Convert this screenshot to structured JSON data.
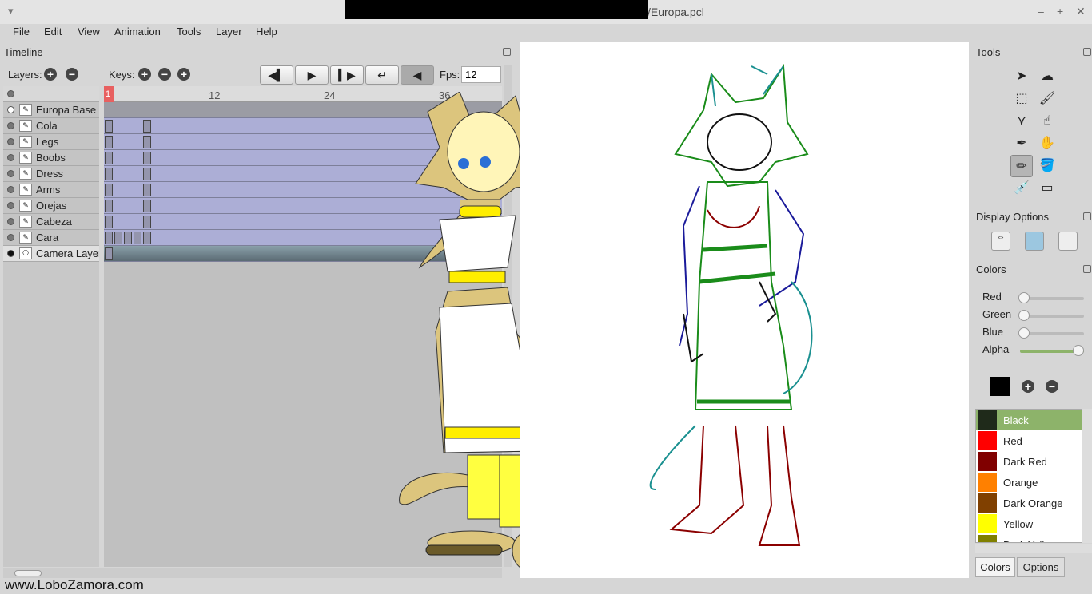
{
  "window": {
    "title": "/Europa.pcl"
  },
  "menu": [
    "File",
    "Edit",
    "View",
    "Animation",
    "Tools",
    "Layer",
    "Help"
  ],
  "timeline": {
    "title": "Timeline",
    "layers_label": "Layers:",
    "keys_label": "Keys:",
    "fps_label": "Fps:",
    "fps": "12",
    "current_frame": "1",
    "ruler_ticks": [
      "12",
      "24",
      "36"
    ],
    "layers": [
      {
        "name": "Europa Base",
        "type": "bitmap",
        "keys": []
      },
      {
        "name": "Cola",
        "keys": [
          1,
          5
        ]
      },
      {
        "name": "Legs",
        "keys": [
          1,
          5
        ]
      },
      {
        "name": "Boobs",
        "keys": [
          1,
          5
        ]
      },
      {
        "name": "Dress",
        "keys": [
          1,
          5
        ]
      },
      {
        "name": "Arms",
        "keys": [
          1,
          5
        ]
      },
      {
        "name": "Orejas",
        "keys": [
          1,
          5
        ]
      },
      {
        "name": "Cabeza",
        "keys": [
          1,
          5
        ]
      },
      {
        "name": "Cara",
        "keys": [
          1,
          2,
          3,
          4,
          5
        ]
      },
      {
        "name": "Camera Layer",
        "type": "camera",
        "keys": [
          1
        ]
      }
    ]
  },
  "tools": {
    "title": "Tools",
    "items": [
      "select",
      "smudge",
      "marquee",
      "brush",
      "polyline",
      "pointer-hand",
      "pen",
      "hand",
      "pencil",
      "bucket",
      "eyedropper",
      "eraser"
    ],
    "active": "pencil"
  },
  "display_options": {
    "title": "Display Options"
  },
  "colors": {
    "title": "Colors",
    "sliders": [
      {
        "label": "Red",
        "value": 0
      },
      {
        "label": "Green",
        "value": 0
      },
      {
        "label": "Blue",
        "value": 0
      },
      {
        "label": "Alpha",
        "value": 255
      }
    ],
    "current": "#000000",
    "swatches": [
      {
        "name": "Black",
        "color": "#1f2a1a"
      },
      {
        "name": "Red",
        "color": "#ff0000"
      },
      {
        "name": "Dark Red",
        "color": "#800000"
      },
      {
        "name": "Orange",
        "color": "#ff8000"
      },
      {
        "name": "Dark Orange",
        "color": "#804000"
      },
      {
        "name": "Yellow",
        "color": "#ffff00"
      },
      {
        "name": "Dark Yellow",
        "color": "#808000"
      }
    ],
    "selected": "Black"
  },
  "tabs": [
    "Colors",
    "Options"
  ],
  "watermark": "www.LoboZamora.com"
}
